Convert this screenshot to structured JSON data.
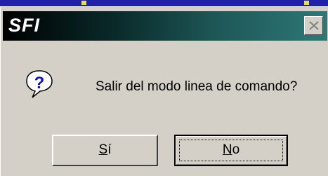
{
  "dialog": {
    "title": "SFI",
    "message": "Salir del modo linea de comando?",
    "icon": "question-icon",
    "close_icon": "close-icon"
  },
  "buttons": {
    "yes_mnemonic": "S",
    "yes_rest": "í",
    "no_mnemonic": "N",
    "no_rest": "o"
  },
  "colors": {
    "title_gradient_start": "#000000",
    "title_gradient_end": "#2f7878",
    "face": "#d4d0c8",
    "icon_blue": "#1010c0"
  }
}
